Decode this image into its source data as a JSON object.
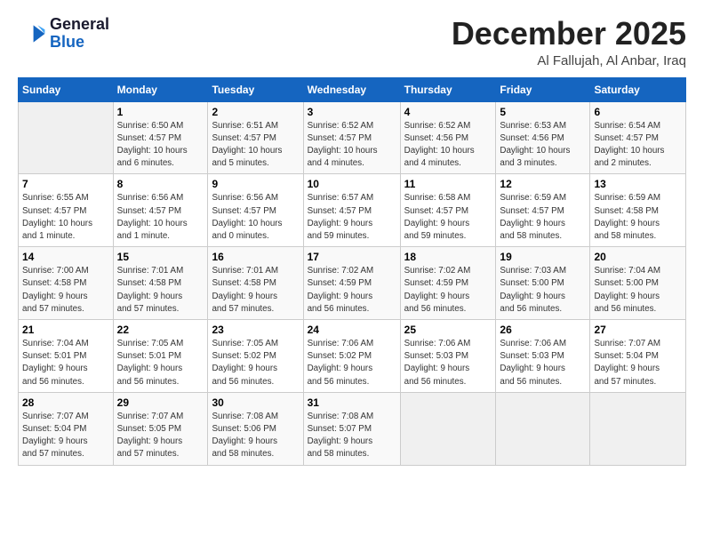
{
  "logo": {
    "line1": "General",
    "line2": "Blue"
  },
  "title": "December 2025",
  "location": "Al Fallujah, Al Anbar, Iraq",
  "days_of_week": [
    "Sunday",
    "Monday",
    "Tuesday",
    "Wednesday",
    "Thursday",
    "Friday",
    "Saturday"
  ],
  "weeks": [
    [
      {
        "day": "",
        "info": ""
      },
      {
        "day": "1",
        "info": "Sunrise: 6:50 AM\nSunset: 4:57 PM\nDaylight: 10 hours\nand 6 minutes."
      },
      {
        "day": "2",
        "info": "Sunrise: 6:51 AM\nSunset: 4:57 PM\nDaylight: 10 hours\nand 5 minutes."
      },
      {
        "day": "3",
        "info": "Sunrise: 6:52 AM\nSunset: 4:57 PM\nDaylight: 10 hours\nand 4 minutes."
      },
      {
        "day": "4",
        "info": "Sunrise: 6:52 AM\nSunset: 4:56 PM\nDaylight: 10 hours\nand 4 minutes."
      },
      {
        "day": "5",
        "info": "Sunrise: 6:53 AM\nSunset: 4:56 PM\nDaylight: 10 hours\nand 3 minutes."
      },
      {
        "day": "6",
        "info": "Sunrise: 6:54 AM\nSunset: 4:57 PM\nDaylight: 10 hours\nand 2 minutes."
      }
    ],
    [
      {
        "day": "7",
        "info": "Sunrise: 6:55 AM\nSunset: 4:57 PM\nDaylight: 10 hours\nand 1 minute."
      },
      {
        "day": "8",
        "info": "Sunrise: 6:56 AM\nSunset: 4:57 PM\nDaylight: 10 hours\nand 1 minute."
      },
      {
        "day": "9",
        "info": "Sunrise: 6:56 AM\nSunset: 4:57 PM\nDaylight: 10 hours\nand 0 minutes."
      },
      {
        "day": "10",
        "info": "Sunrise: 6:57 AM\nSunset: 4:57 PM\nDaylight: 9 hours\nand 59 minutes."
      },
      {
        "day": "11",
        "info": "Sunrise: 6:58 AM\nSunset: 4:57 PM\nDaylight: 9 hours\nand 59 minutes."
      },
      {
        "day": "12",
        "info": "Sunrise: 6:59 AM\nSunset: 4:57 PM\nDaylight: 9 hours\nand 58 minutes."
      },
      {
        "day": "13",
        "info": "Sunrise: 6:59 AM\nSunset: 4:58 PM\nDaylight: 9 hours\nand 58 minutes."
      }
    ],
    [
      {
        "day": "14",
        "info": "Sunrise: 7:00 AM\nSunset: 4:58 PM\nDaylight: 9 hours\nand 57 minutes."
      },
      {
        "day": "15",
        "info": "Sunrise: 7:01 AM\nSunset: 4:58 PM\nDaylight: 9 hours\nand 57 minutes."
      },
      {
        "day": "16",
        "info": "Sunrise: 7:01 AM\nSunset: 4:58 PM\nDaylight: 9 hours\nand 57 minutes."
      },
      {
        "day": "17",
        "info": "Sunrise: 7:02 AM\nSunset: 4:59 PM\nDaylight: 9 hours\nand 56 minutes."
      },
      {
        "day": "18",
        "info": "Sunrise: 7:02 AM\nSunset: 4:59 PM\nDaylight: 9 hours\nand 56 minutes."
      },
      {
        "day": "19",
        "info": "Sunrise: 7:03 AM\nSunset: 5:00 PM\nDaylight: 9 hours\nand 56 minutes."
      },
      {
        "day": "20",
        "info": "Sunrise: 7:04 AM\nSunset: 5:00 PM\nDaylight: 9 hours\nand 56 minutes."
      }
    ],
    [
      {
        "day": "21",
        "info": "Sunrise: 7:04 AM\nSunset: 5:01 PM\nDaylight: 9 hours\nand 56 minutes."
      },
      {
        "day": "22",
        "info": "Sunrise: 7:05 AM\nSunset: 5:01 PM\nDaylight: 9 hours\nand 56 minutes."
      },
      {
        "day": "23",
        "info": "Sunrise: 7:05 AM\nSunset: 5:02 PM\nDaylight: 9 hours\nand 56 minutes."
      },
      {
        "day": "24",
        "info": "Sunrise: 7:06 AM\nSunset: 5:02 PM\nDaylight: 9 hours\nand 56 minutes."
      },
      {
        "day": "25",
        "info": "Sunrise: 7:06 AM\nSunset: 5:03 PM\nDaylight: 9 hours\nand 56 minutes."
      },
      {
        "day": "26",
        "info": "Sunrise: 7:06 AM\nSunset: 5:03 PM\nDaylight: 9 hours\nand 56 minutes."
      },
      {
        "day": "27",
        "info": "Sunrise: 7:07 AM\nSunset: 5:04 PM\nDaylight: 9 hours\nand 57 minutes."
      }
    ],
    [
      {
        "day": "28",
        "info": "Sunrise: 7:07 AM\nSunset: 5:04 PM\nDaylight: 9 hours\nand 57 minutes."
      },
      {
        "day": "29",
        "info": "Sunrise: 7:07 AM\nSunset: 5:05 PM\nDaylight: 9 hours\nand 57 minutes."
      },
      {
        "day": "30",
        "info": "Sunrise: 7:08 AM\nSunset: 5:06 PM\nDaylight: 9 hours\nand 58 minutes."
      },
      {
        "day": "31",
        "info": "Sunrise: 7:08 AM\nSunset: 5:07 PM\nDaylight: 9 hours\nand 58 minutes."
      },
      {
        "day": "",
        "info": ""
      },
      {
        "day": "",
        "info": ""
      },
      {
        "day": "",
        "info": ""
      }
    ]
  ]
}
